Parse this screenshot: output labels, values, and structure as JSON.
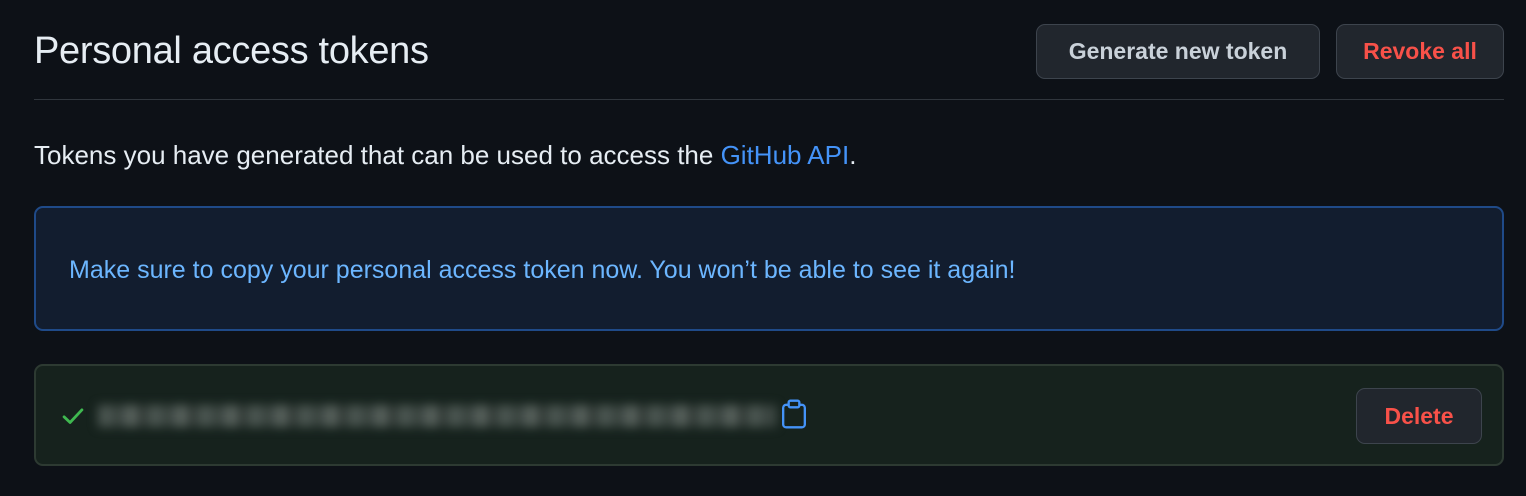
{
  "header": {
    "title": "Personal access tokens",
    "generate_label": "Generate new token",
    "revoke_label": "Revoke all"
  },
  "intro": {
    "text": "Tokens you have generated that can be used to access the ",
    "link": "GitHub API",
    "suffix": "."
  },
  "flash": {
    "message": "Make sure to copy your personal access token now. You won’t be able to see it again!"
  },
  "token": {
    "status_icon": "check-icon",
    "value": "",
    "copy_icon": "copy-icon",
    "delete_label": "Delete"
  },
  "colors": {
    "background": "#0d1117",
    "link": "#4493f8",
    "flash_text": "#6cb6ff",
    "danger": "#f85149",
    "success": "#3fb950"
  }
}
